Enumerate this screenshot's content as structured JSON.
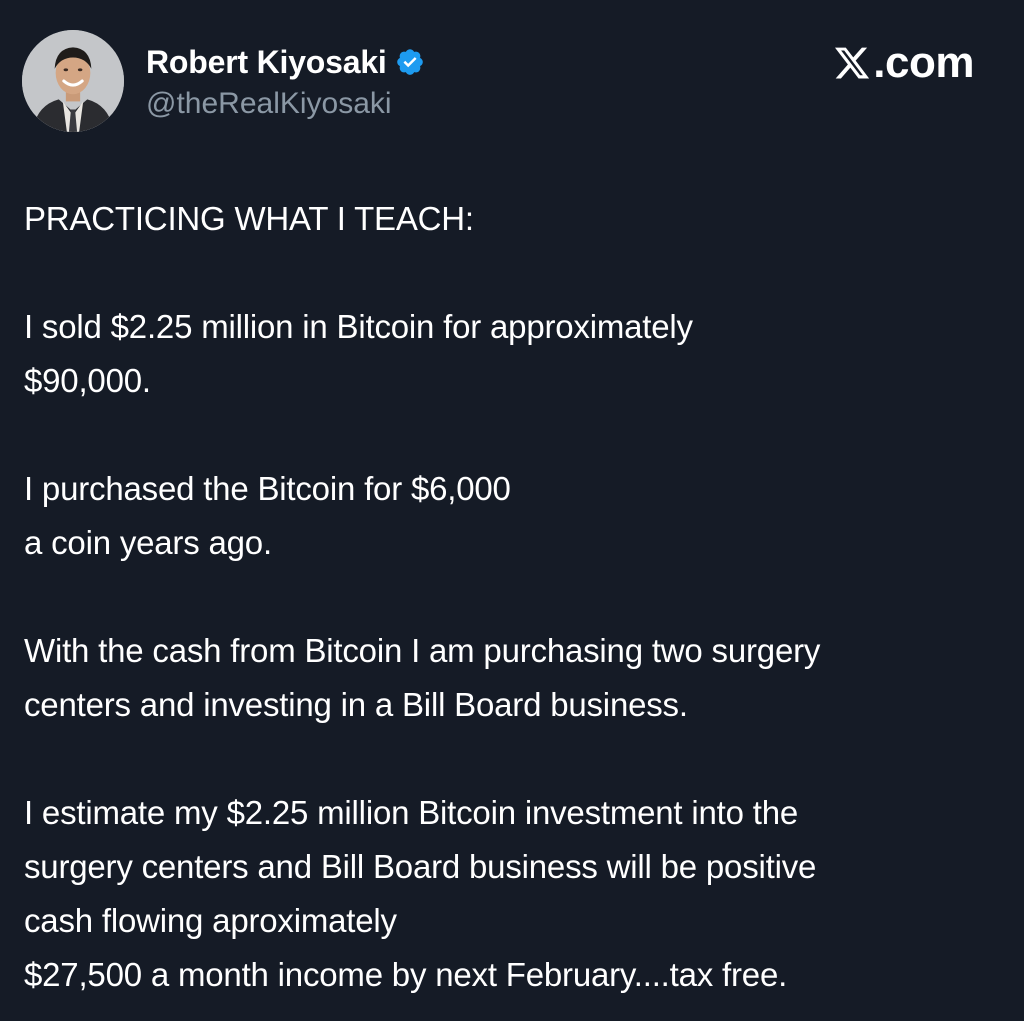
{
  "header": {
    "display_name": "Robert Kiyosaki",
    "handle": "@theRealKiyosaki",
    "brand": "X.com",
    "verified_color": "#1d9bf0",
    "avatar_icon": "profile-photo",
    "verified_icon": "verified-badge",
    "brand_icon": "x-logo"
  },
  "post": {
    "paragraphs": [
      [
        "PRACTICING WHAT I TEACH:"
      ],
      [
        "I sold $2.25 million in Bitcoin for approximately",
        "$90,000."
      ],
      [
        "I purchased the Bitcoin for $6,000",
        "a coin years ago."
      ],
      [
        "With the cash from Bitcoin I am purchasing two surgery",
        "centers and investing in a Bill Board business."
      ],
      [
        "I estimate my $2.25 million Bitcoin investment into the",
        "surgery centers and Bill Board business will be positive",
        "cash flowing aproximately",
        "$27,500 a month income by next February....tax free."
      ]
    ]
  },
  "colors": {
    "background": "#151b26",
    "text": "#ffffff",
    "secondary_text": "#8b98a5"
  }
}
